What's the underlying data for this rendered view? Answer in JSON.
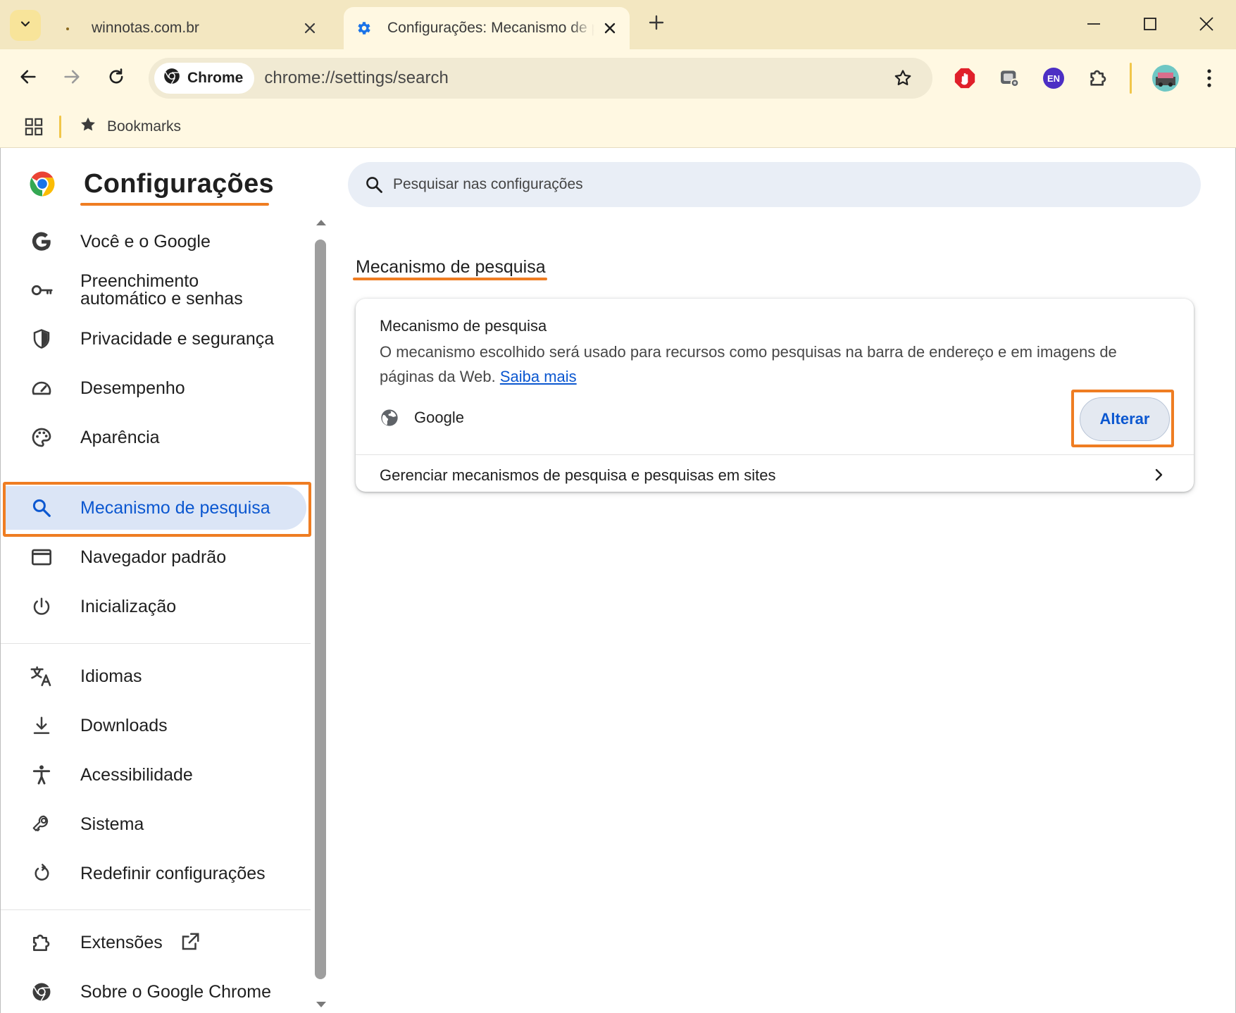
{
  "browser": {
    "tabs": [
      {
        "title": "winnotas.com.br",
        "active": false
      },
      {
        "title": "Configurações: Mecanismo de pesquisa",
        "active": true
      }
    ],
    "omnibox": {
      "chip_label": "Chrome",
      "url": "chrome://settings/search"
    },
    "extensions": [
      {
        "name": "adblock-icon",
        "color": "#e0202a"
      },
      {
        "name": "screen-capture-icon",
        "color": "#5f6368"
      },
      {
        "name": "language-en-icon",
        "label": "EN",
        "color": "#4c2fc4"
      },
      {
        "name": "puzzle-icon",
        "color": "#3c3c3c"
      }
    ],
    "bookmarks_bar": {
      "label": "Bookmarks"
    }
  },
  "settings": {
    "title": "Configurações",
    "search_placeholder": "Pesquisar nas configurações",
    "nav": [
      {
        "label": "Você e o Google",
        "icon": "google-icon"
      },
      {
        "label": "Preenchimento automático e senhas",
        "icon": "key-icon"
      },
      {
        "label": "Privacidade e segurança",
        "icon": "shield-icon"
      },
      {
        "label": "Desempenho",
        "icon": "speedometer-icon"
      },
      {
        "label": "Aparência",
        "icon": "palette-icon"
      },
      {
        "label": "Mecanismo de pesquisa",
        "icon": "search-icon",
        "active": true
      },
      {
        "label": "Navegador padrão",
        "icon": "browser-window-icon"
      },
      {
        "label": "Inicialização",
        "icon": "power-icon"
      },
      {
        "label": "Idiomas",
        "icon": "translate-icon"
      },
      {
        "label": "Downloads",
        "icon": "download-icon"
      },
      {
        "label": "Acessibilidade",
        "icon": "accessibility-icon"
      },
      {
        "label": "Sistema",
        "icon": "wrench-icon"
      },
      {
        "label": "Redefinir configurações",
        "icon": "reset-icon"
      },
      {
        "label": "Extensões",
        "icon": "puzzle-icon"
      },
      {
        "label": "Sobre o Google Chrome",
        "icon": "chrome-icon"
      }
    ],
    "section_title": "Mecanismo de pesquisa",
    "card": {
      "heading": "Mecanismo de pesquisa",
      "description": "O mecanismo escolhido será usado para recursos como pesquisas na barra de endereço e em imagens de páginas da Web.",
      "learn_more": "Saiba mais",
      "engine": "Google",
      "change_button": "Alterar",
      "manage_label": "Gerenciar mecanismos de pesquisa e pesquisas em sites"
    },
    "highlight_color": "#ef7d22",
    "accent_color": "#0b57d0"
  }
}
